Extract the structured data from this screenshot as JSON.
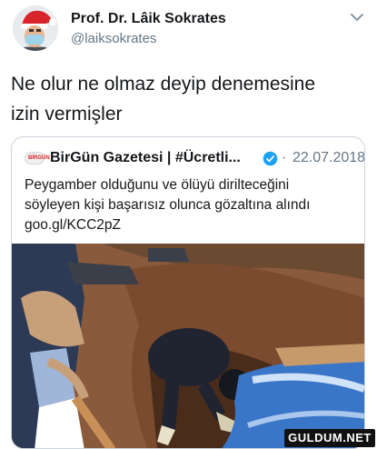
{
  "author": {
    "display_name": "Prof. Dr. Lâik Sokrates",
    "handle": "@laiksokrates",
    "avatar_icon": "santa-hat-mask-avatar"
  },
  "tweet": {
    "text_line1": "Ne olur ne olmaz deyip denemesine",
    "text_line2": "izin vermişler"
  },
  "quoted_tweet": {
    "author_name": "BirGün Gazetesi | #Ücretli...",
    "logo_text": "BİRGÜN",
    "verified_icon": "verified-badge-icon",
    "separator": "·",
    "date": "22.07.2018",
    "text_line1": "Peygamber olduğunu ve ölüyü diriltеceğini",
    "text_line2": "söyleyen kişi başarısız olunca gözaltına alındı",
    "text_line3": "goo.gl/KCC2pZ",
    "media_icon": "news-photo-image"
  },
  "watermark": {
    "text": "GULDUM.NET"
  },
  "colors": {
    "text": "#14171a",
    "secondary": "#657786",
    "verified": "#1da1f2",
    "border": "#ccd6dd"
  }
}
